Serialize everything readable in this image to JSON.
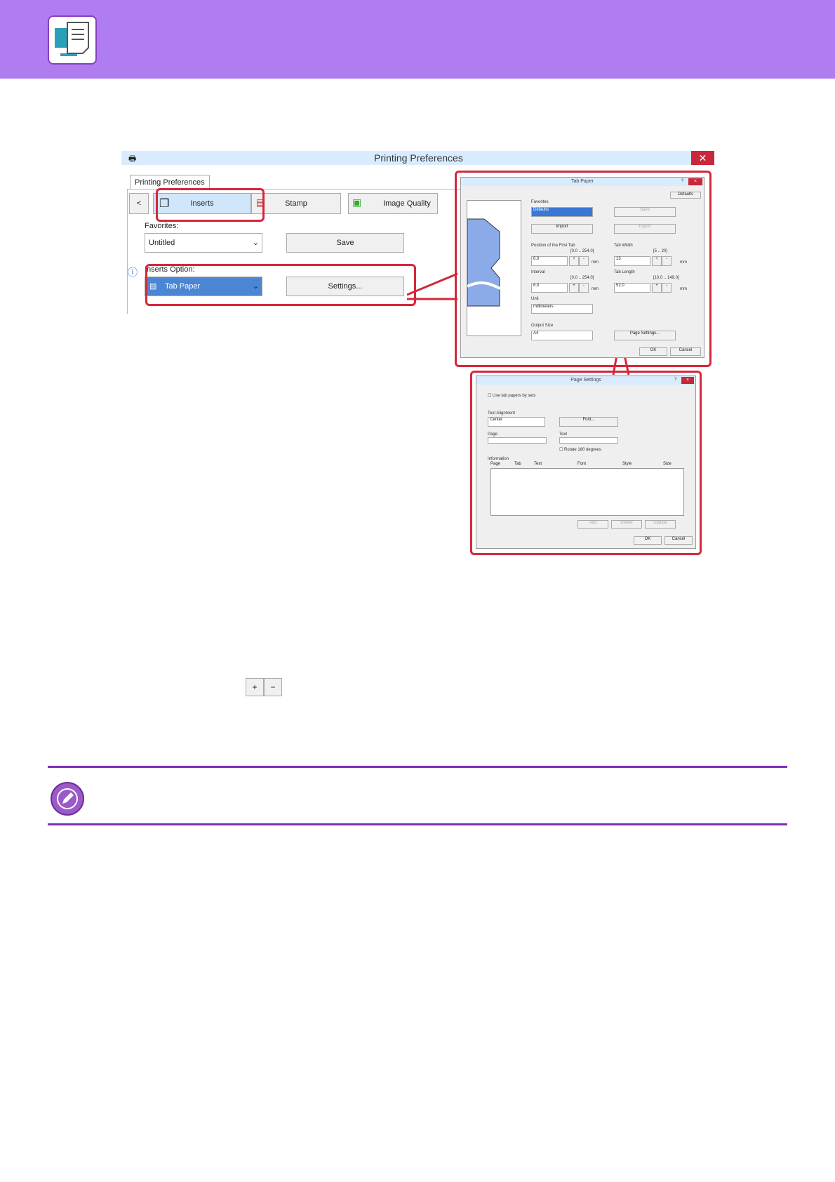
{
  "colors": {
    "header": "#b07df0",
    "accent": "#d5273c",
    "rule": "#7d2fb5"
  },
  "icons": {
    "header": "computer-document-icon",
    "note": "pencil-note-icon"
  },
  "main_window": {
    "title": "Printing Preferences",
    "tab": "Printing Preferences",
    "nav_back": "<",
    "toolbar": [
      "Inserts",
      "Stamp",
      "Image Quality"
    ],
    "favorites_label": "Favorites:",
    "favorites_value": "Untitled",
    "save_label": "Save",
    "inserts_option_label": "Inserts Option:",
    "inserts_option_value": "Tab Paper",
    "settings_label": "Settings..."
  },
  "tab_paper": {
    "title": "Tab Paper",
    "help": "?",
    "close": "×",
    "defaults_btn": "Defaults",
    "favorites_label": "Favorites",
    "favorites_value": "Defaults",
    "save_btn": "Save",
    "import_btn": "Import",
    "export_btn": "Export",
    "pos_first_label": "Position of the First Tab",
    "pos_first_range": "[0.0 .. 254.0]",
    "pos_first_value": "6.0",
    "tab_width_label": "Tab Width",
    "tab_width_range": "[5 .. 20]",
    "tab_width_value": "13",
    "interval_label": "Interval",
    "interval_range": "[0.0 .. 254.0]",
    "interval_value": "6.0",
    "tab_length_label": "Tab Length",
    "tab_length_range": "[10.0 .. 149.0]",
    "tab_length_value": "52.0",
    "unit_label": "Unit",
    "unit_value": "millimeters",
    "mm": "mm",
    "plus": "+",
    "minus": "-",
    "output_size_label": "Output Size",
    "output_size_value": "A4",
    "page_settings_btn": "Page Settings...",
    "ok": "OK",
    "cancel": "Cancel"
  },
  "page_settings": {
    "title": "Page Settings",
    "help": "?",
    "close": "×",
    "use_tab_papers": "Use tab papers by sets",
    "text_alignment_label": "Text Alignment",
    "text_alignment_value": "Center",
    "font_btn": "Font...",
    "page_label": "Page",
    "text_label": "Text",
    "rotate": "Rotate 180 degrees",
    "information_label": "Information",
    "columns": [
      "Page",
      "Tab",
      "Text",
      "Font",
      "Style",
      "Size"
    ],
    "add": "Add",
    "delete": "Delete",
    "update": "Update",
    "ok": "OK",
    "cancel": "Cancel"
  },
  "stepper": {
    "plus": "+",
    "minus": "−"
  }
}
